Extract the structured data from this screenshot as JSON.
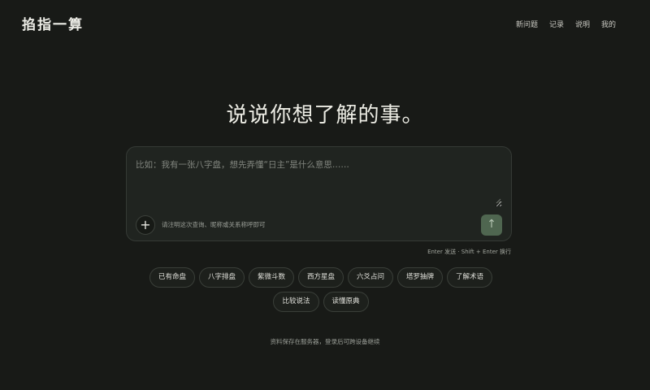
{
  "brand": {
    "logo": "掐指一算"
  },
  "nav": {
    "items": [
      "新问题",
      "记录",
      "说明",
      "我的"
    ]
  },
  "main": {
    "headline": "说说你想了解的事。",
    "composer": {
      "placeholder": "比如：我有一张八字盘，想先弄懂“日主”是什么意思……",
      "value": "",
      "attach_icon": "plus-icon",
      "hint": "请注明这次查询、昵称或关系称呼即可",
      "send_icon": "arrow-up-icon",
      "keyboard_hint": "Enter 发送 · Shift + Enter 换行"
    },
    "chips": [
      "已有命盘",
      "八字排盘",
      "紫微斗数",
      "西方星盘",
      "六爻占问",
      "塔罗抽牌",
      "了解术语",
      "比较说法",
      "读懂原典"
    ],
    "footer_note": "资料保存在服务器，登录后可跨设备继续"
  },
  "colors": {
    "background": "#181a17",
    "composer_bg": "#202420",
    "send_button": "#4f6650"
  }
}
